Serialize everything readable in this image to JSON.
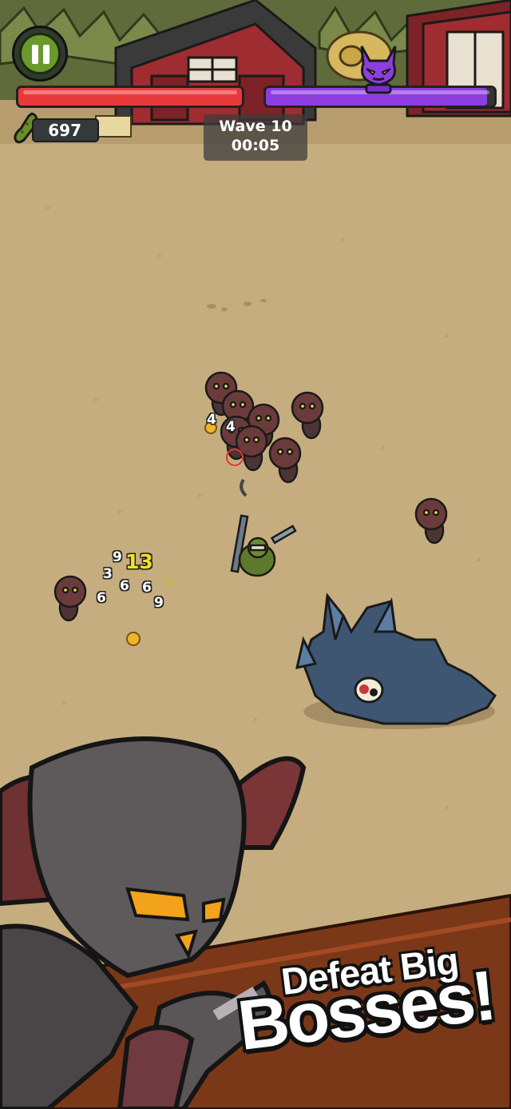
{
  "hud": {
    "coins": "697",
    "wave_label": "Wave 10",
    "timer": "00:05",
    "player_health_color": "#e83a3c",
    "boss_health_color": "#8e3de0"
  },
  "damage_numbers": [
    "4",
    "4",
    "9",
    "13",
    "3",
    "6",
    "6",
    "6",
    "6",
    "9"
  ],
  "promo": {
    "line1": "Defeat Big",
    "line2": "Bosses!"
  }
}
